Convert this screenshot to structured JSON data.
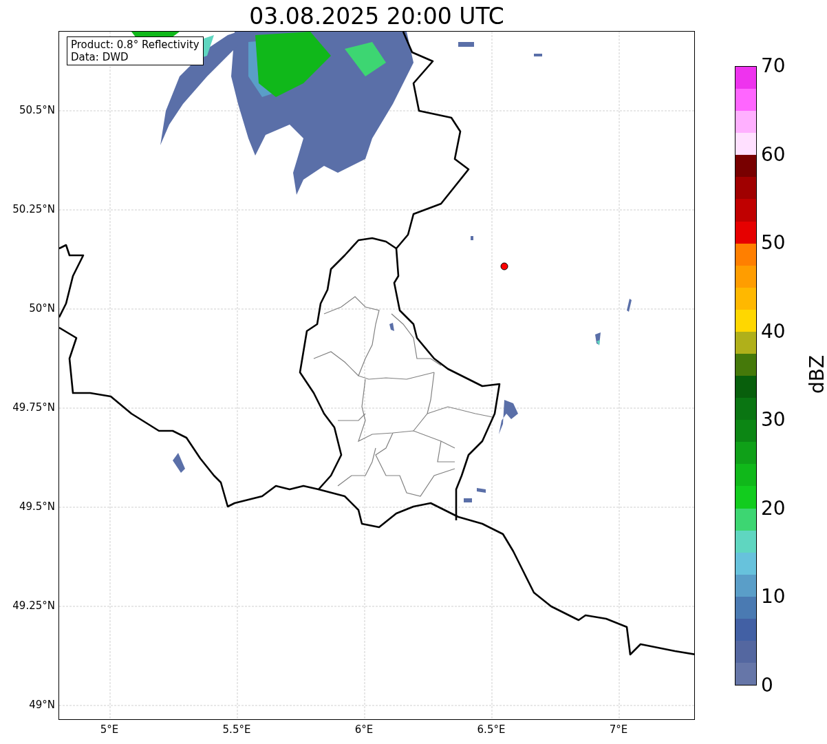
{
  "title": "03.08.2025 20:00 UTC",
  "info_box": {
    "lines": [
      "Product: 0.8° Reflectivity",
      "Data: DWD"
    ]
  },
  "map": {
    "lat_ticks": [
      "50.5°N",
      "50.25°N",
      "50°N",
      "49.75°N",
      "49.5°N",
      "49.25°N",
      "49°N"
    ],
    "lon_ticks": [
      "5°E",
      "5.5°E",
      "6°E",
      "6.5°E",
      "7°E"
    ]
  },
  "colorbar": {
    "label": "dBZ",
    "ticks": [
      "70",
      "60",
      "50",
      "40",
      "30",
      "20",
      "10",
      "0"
    ],
    "bins": [
      {
        "color": "#ee33ee"
      },
      {
        "color": "#ff66ff"
      },
      {
        "color": "#ffb0ff"
      },
      {
        "color": "#ffe0ff"
      },
      {
        "color": "#780000"
      },
      {
        "color": "#a00000"
      },
      {
        "color": "#c00000"
      },
      {
        "color": "#e60000"
      },
      {
        "color": "#ff7f00"
      },
      {
        "color": "#ff9d00"
      },
      {
        "color": "#ffb800"
      },
      {
        "color": "#ffd700"
      },
      {
        "color": "#b0b01a"
      },
      {
        "color": "#45790a"
      },
      {
        "color": "#085f0c"
      },
      {
        "color": "#0a7512"
      },
      {
        "color": "#0c8614"
      },
      {
        "color": "#0fa018"
      },
      {
        "color": "#10b81a"
      },
      {
        "color": "#12cc1e"
      },
      {
        "color": "#3dd672"
      },
      {
        "color": "#5fd6c0"
      },
      {
        "color": "#67c2dc"
      },
      {
        "color": "#5a9ec8"
      },
      {
        "color": "#4a7ab2"
      },
      {
        "color": "#4260a4"
      },
      {
        "color": "#5467a0"
      },
      {
        "color": "#6676a8"
      }
    ]
  }
}
